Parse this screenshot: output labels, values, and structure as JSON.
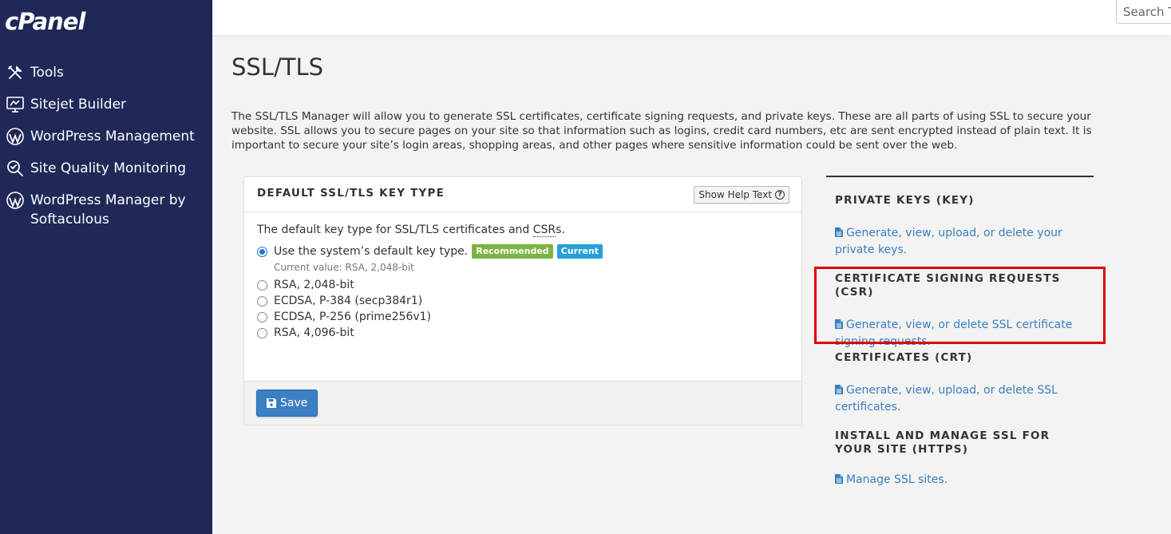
{
  "app": {
    "logo": "cPanel"
  },
  "search": {
    "placeholder": "Search Tools"
  },
  "sidebar": {
    "items": [
      {
        "label": "Tools",
        "icon": "tools-icon"
      },
      {
        "label": "Sitejet Builder",
        "icon": "monitor-icon"
      },
      {
        "label": "WordPress Management",
        "icon": "wordpress-icon"
      },
      {
        "label": "Site Quality Monitoring",
        "icon": "magnifier-icon"
      },
      {
        "label": "WordPress Manager by Softaculous",
        "icon": "wordpress-icon"
      }
    ]
  },
  "page": {
    "title": "SSL/TLS",
    "intro": "The SSL/TLS Manager will allow you to generate SSL certificates, certificate signing requests, and private keys. These are all parts of using SSL to secure your website. SSL allows you to secure pages on your site so that information such as logins, credit card numbers, etc are sent encrypted instead of plain text. It is important to secure your site’s login areas, shopping areas, and other pages where sensitive information could be sent over the web."
  },
  "key_type_card": {
    "title": "DEFAULT SSL/TLS KEY TYPE",
    "help_label": "Show Help Text",
    "desc_prefix": "The default key type for SSL/TLS certificates and ",
    "desc_abbr": "CSR",
    "desc_suffix": "s.",
    "options": [
      {
        "label": "Use the system’s default key type.",
        "checked": true
      },
      {
        "label": "RSA, 2,048-bit",
        "checked": false
      },
      {
        "label": "ECDSA, P-384 (secp384r1)",
        "checked": false
      },
      {
        "label": "ECDSA, P-256 (prime256v1)",
        "checked": false
      },
      {
        "label": "RSA, 4,096-bit",
        "checked": false
      }
    ],
    "badges": {
      "recommended": "Recommended",
      "current": "Current"
    },
    "current_value": "Current value: RSA, 2,048-bit",
    "save_label": "Save"
  },
  "right": {
    "sections": [
      {
        "title": "PRIVATE KEYS (KEY)",
        "link": "Generate, view, upload, or delete your private keys."
      },
      {
        "title": "CERTIFICATE SIGNING REQUESTS (CSR)",
        "link": "Generate, view, or delete SSL certificate signing requests."
      },
      {
        "title": "CERTIFICATES (CRT)",
        "link": "Generate, view, upload, or delete SSL certificates."
      },
      {
        "title": "INSTALL AND MANAGE SSL FOR YOUR SITE (HTTPS)",
        "link": "Manage SSL sites."
      }
    ]
  },
  "colors": {
    "sidebar": "#1f2857",
    "link": "#3a7fbf",
    "highlight": "#e00000",
    "save": "#3b80c4"
  }
}
